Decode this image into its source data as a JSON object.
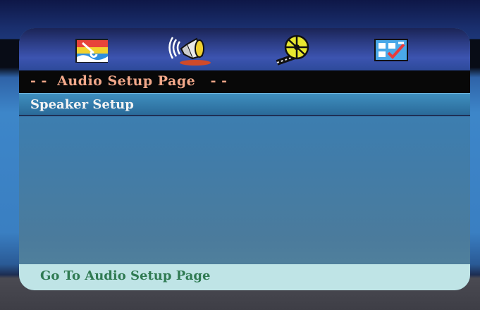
{
  "tabs": [
    {
      "name": "general-setup",
      "icon": "wrench-flag-icon"
    },
    {
      "name": "audio-setup",
      "icon": "speaker-icon"
    },
    {
      "name": "video-setup",
      "icon": "film-reel-icon"
    },
    {
      "name": "preference-setup",
      "icon": "checklist-icon"
    }
  ],
  "page": {
    "title": "- -  Audio Setup Page   - -"
  },
  "menu": {
    "items": [
      {
        "label": "Speaker Setup"
      }
    ]
  },
  "status": {
    "text": "Go To Audio Setup Page"
  },
  "colors": {
    "title_text": "#f2a88a",
    "status_text": "#2f7a52",
    "status_bg": "#bfe4e6"
  }
}
